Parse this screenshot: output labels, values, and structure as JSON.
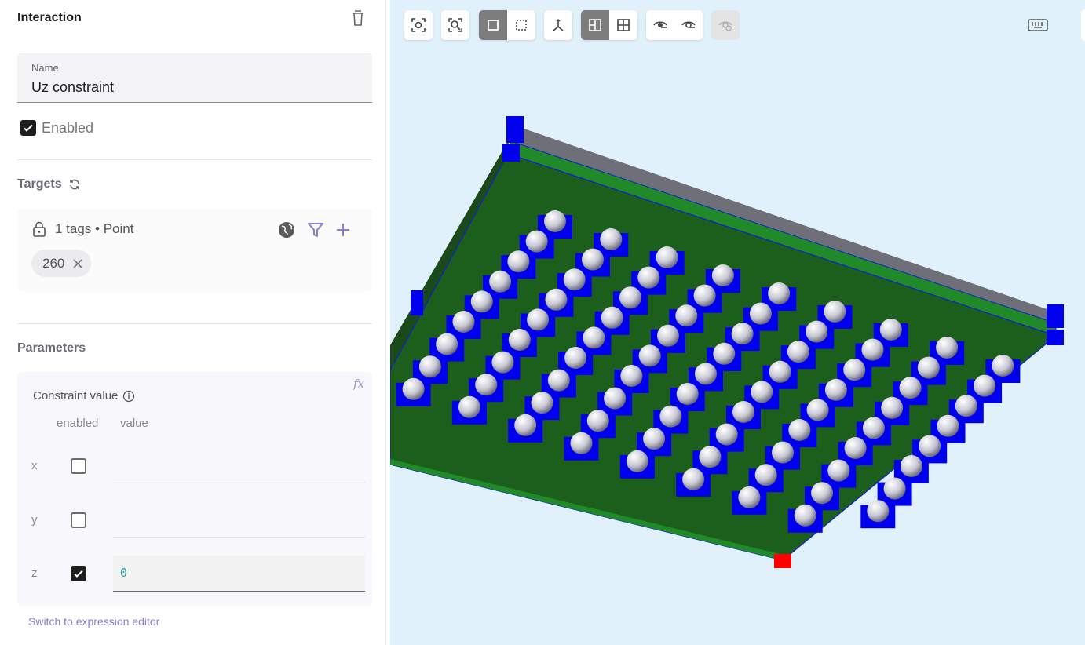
{
  "panel": {
    "title": "Interaction",
    "name_label": "Name",
    "name_value": "Uz constraint",
    "enabled_label": "Enabled",
    "enabled_checked": true,
    "targets_title": "Targets",
    "targets_summary": "1 tags • Point",
    "tag_chip": "260",
    "parameters_title": "Parameters",
    "constraint_label": "Constraint value",
    "col_enabled": "enabled",
    "col_value": "value",
    "rows": [
      {
        "axis": "x",
        "enabled": false,
        "value": ""
      },
      {
        "axis": "y",
        "enabled": false,
        "value": ""
      },
      {
        "axis": "z",
        "enabled": true,
        "value": "0"
      }
    ],
    "fx_label": "fx",
    "switch_link": "Switch to expression editor"
  },
  "toolbar": {
    "icons": [
      "fit-view-icon",
      "zoom-region-icon",
      "select-box-icon",
      "select-dashed-icon",
      "axes-icon",
      "front-view-icon",
      "grid-view-icon",
      "hide-icon",
      "show-icon",
      "show-all-icon",
      "keyboard-icon"
    ]
  },
  "colors": {
    "plate_top": "#1c5e1c",
    "plate_edge": "#1f8a27",
    "node_marker": "#0000ee",
    "selected_node": "#ff0000",
    "viewport_bg": "#e1f1fb",
    "accent": "#8a7fd0"
  }
}
